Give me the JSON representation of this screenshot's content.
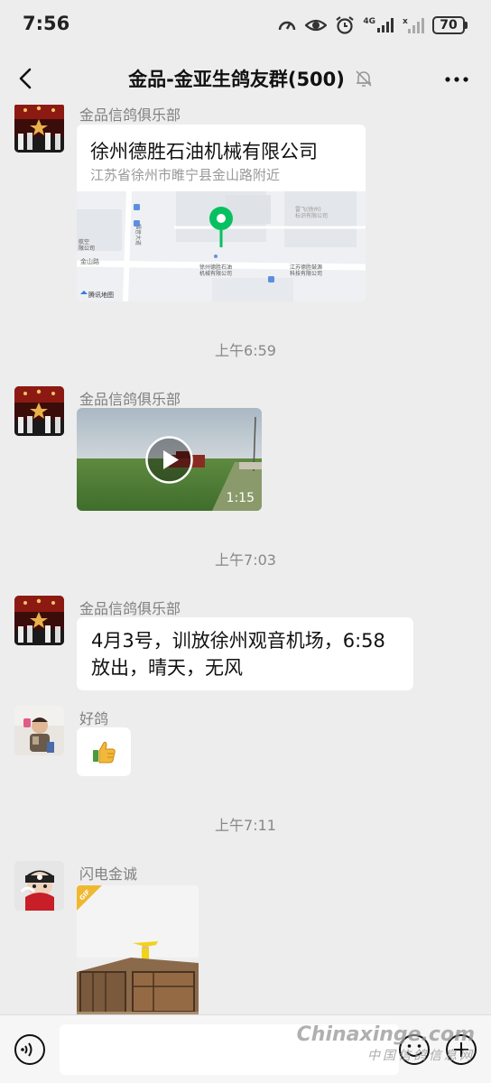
{
  "status_bar": {
    "time": "7:56",
    "network": "4G",
    "battery": "70"
  },
  "header": {
    "title": "金品-金亚生鸽友群(500)"
  },
  "messages": [
    {
      "sender": "金品信鸽俱乐部",
      "type": "location",
      "place_name": "徐州德胜石油机械有限公司",
      "address": "江苏省徐州市睢宁县金山路附近",
      "map_labels": {
        "road1": "金山路",
        "road2": "福音大道",
        "poi_center": "徐州德胜石油\n机械有限公司",
        "poi_right": "江苏德胜鼓源\n科技有限公司",
        "poi_top_right": "雷飞(徐州)\n标识有限公司",
        "poi_left": "航空\n限公司",
        "provider": "腾讯地图"
      }
    },
    {
      "type": "timestamp",
      "text": "上午6:59"
    },
    {
      "sender": "金品信鸽俱乐部",
      "type": "video",
      "duration": "1:15"
    },
    {
      "type": "timestamp",
      "text": "上午7:03"
    },
    {
      "sender": "金品信鸽俱乐部",
      "type": "text",
      "text": "4月3号，训放徐州观音机场，6:58放出，晴天，无风"
    },
    {
      "sender": "好鸽",
      "type": "emoji",
      "emoji": "thumbs-up"
    },
    {
      "type": "timestamp",
      "text": "上午7:11"
    },
    {
      "sender": "闪电金诚",
      "type": "gif",
      "badge": "GIF"
    }
  ],
  "watermark": {
    "line1": "Chinaxinge.com",
    "line2": "中国信鸽信息网"
  },
  "colors": {
    "background": "#ededed",
    "bubble": "#ffffff",
    "map_pin": "#07c160",
    "timestamp": "#888888"
  }
}
